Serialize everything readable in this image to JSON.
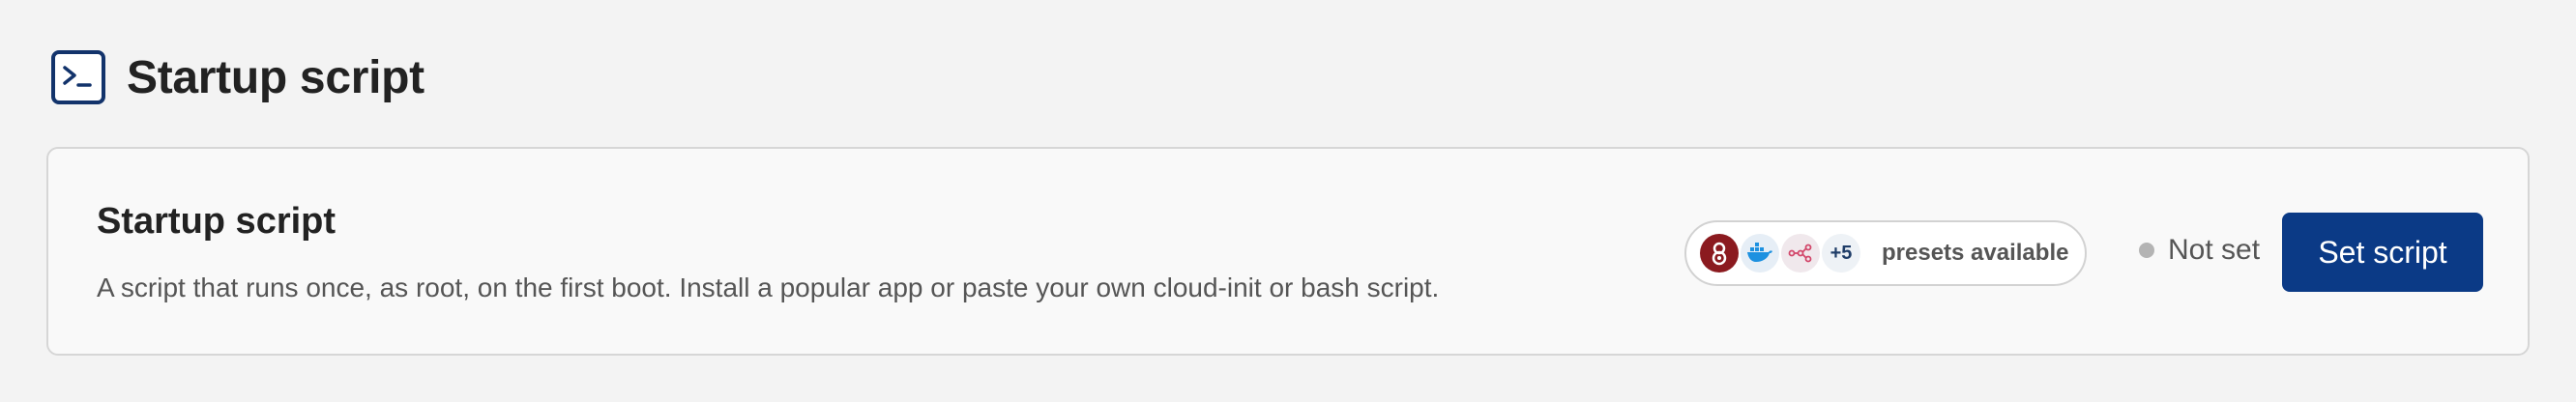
{
  "header": {
    "title": "Startup script",
    "icon": "terminal-icon"
  },
  "card": {
    "title": "Startup script",
    "description": "A script that runs once, as root, on the first boot. Install a popular app or paste your own cloud-init or bash script.",
    "presets": {
      "icons": [
        "app-preset-icon",
        "docker-icon",
        "network-preset-icon"
      ],
      "extra_count": "+5",
      "label": "presets available"
    },
    "status": {
      "text": "Not set",
      "dot_color": "#b4b4b4"
    },
    "action_label": "Set script"
  },
  "colors": {
    "accent": "#0b3a86",
    "icon_navy": "#12336b"
  }
}
